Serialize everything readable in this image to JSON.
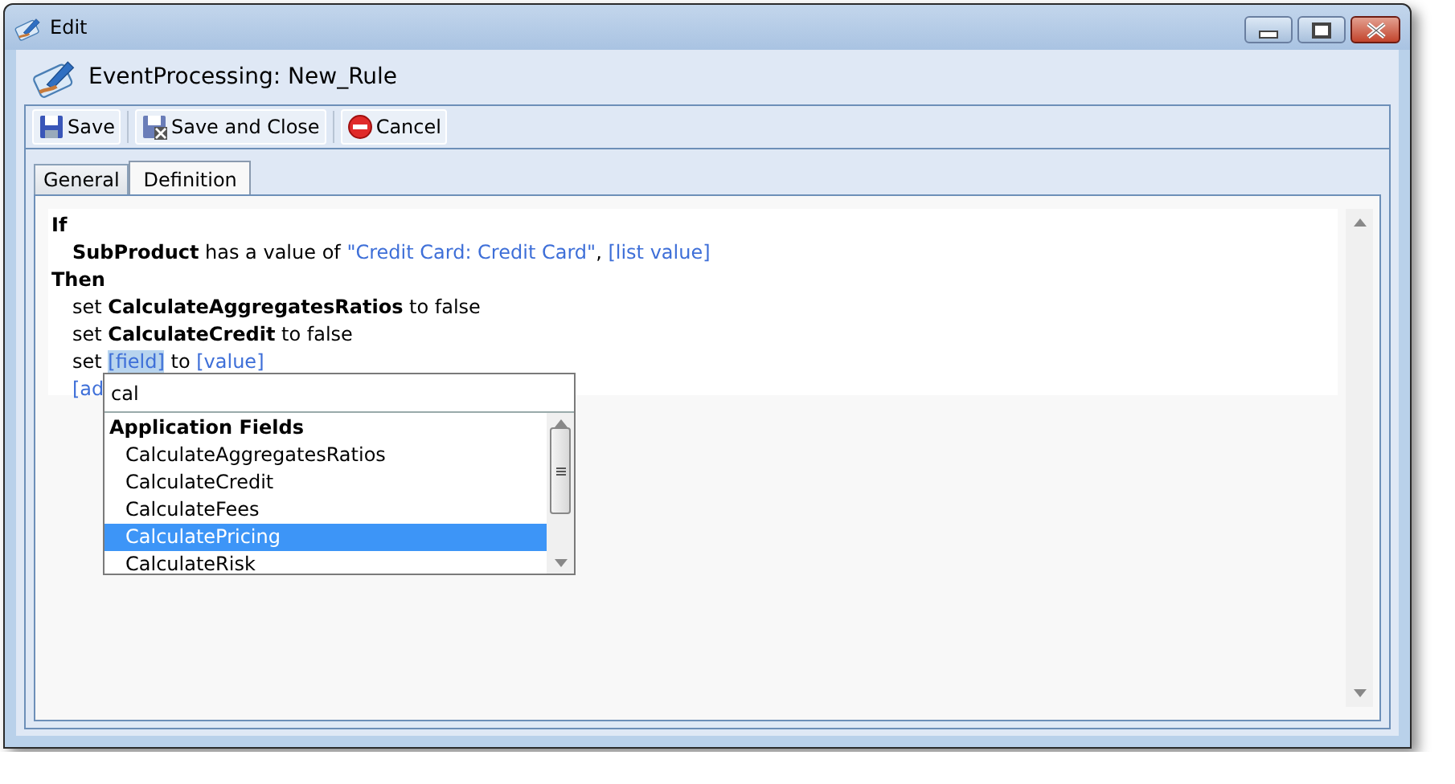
{
  "window": {
    "title": "Edit"
  },
  "header": {
    "title": "EventProcessing: New_Rule"
  },
  "toolbar": [
    {
      "label": "Save",
      "kind": "save"
    },
    {
      "label": "Save and Close",
      "kind": "save-close"
    },
    {
      "label": "Cancel",
      "kind": "cancel"
    }
  ],
  "tabs": [
    {
      "label": "General",
      "selected": false
    },
    {
      "label": "Definition",
      "selected": true
    }
  ],
  "rule": {
    "lines": [
      {
        "kind": "keyword",
        "segments": [
          {
            "kind": "bold",
            "text": "If"
          }
        ]
      },
      {
        "kind": "statement",
        "segments": [
          {
            "kind": "bold",
            "text": "SubProduct"
          },
          {
            "kind": "text",
            "text": " has a value of "
          },
          {
            "kind": "link",
            "text": "\"Credit Card: Credit Card\"",
            "selected": false
          },
          {
            "kind": "text",
            "text": ", "
          },
          {
            "kind": "link",
            "text": "[list value]",
            "selected": false
          }
        ]
      },
      {
        "kind": "keyword",
        "segments": [
          {
            "kind": "bold",
            "text": "Then"
          }
        ]
      },
      {
        "kind": "statement",
        "segments": [
          {
            "kind": "text",
            "text": "set "
          },
          {
            "kind": "bold",
            "text": "CalculateAggregatesRatios"
          },
          {
            "kind": "text",
            "text": " to false"
          }
        ]
      },
      {
        "kind": "statement",
        "segments": [
          {
            "kind": "text",
            "text": "set "
          },
          {
            "kind": "bold",
            "text": "CalculateCredit"
          },
          {
            "kind": "text",
            "text": " to false"
          }
        ]
      },
      {
        "kind": "statement",
        "segments": [
          {
            "kind": "text",
            "text": "set "
          },
          {
            "kind": "link",
            "text": "[field]",
            "selected": true
          },
          {
            "kind": "text",
            "text": " to "
          },
          {
            "kind": "link",
            "text": "[value]",
            "selected": false
          }
        ]
      },
      {
        "kind": "statement",
        "segments": [
          {
            "kind": "link",
            "text": "[ad",
            "selected": false
          }
        ]
      }
    ]
  },
  "popup": {
    "query": "cal",
    "group": "Application Fields",
    "items": [
      {
        "label": "CalculateAggregatesRatios",
        "selected": false
      },
      {
        "label": "CalculateCredit",
        "selected": false
      },
      {
        "label": "CalculateFees",
        "selected": false
      },
      {
        "label": "CalculatePricing",
        "selected": true
      },
      {
        "label": "CalculateRisk",
        "selected": false
      }
    ]
  }
}
